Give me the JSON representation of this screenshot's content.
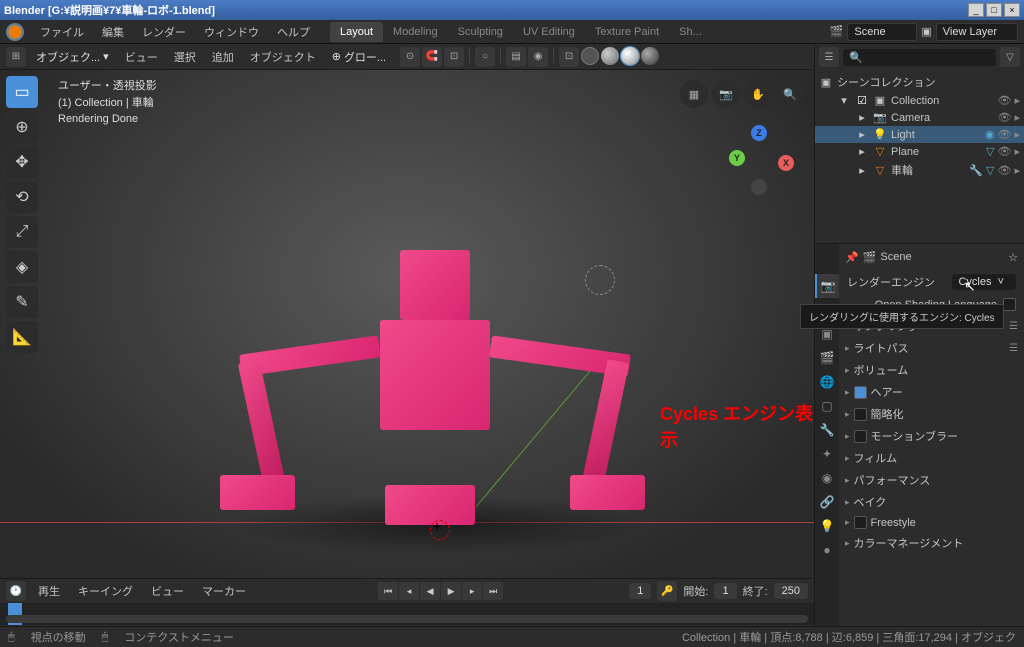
{
  "titlebar": {
    "text": "Blender [G:¥説明画¥7¥車輪-ロボ-1.blend]",
    "min": "_",
    "max": "□",
    "close": "×"
  },
  "menubar": {
    "items": [
      "ファイル",
      "編集",
      "レンダー",
      "ウィンドウ",
      "ヘルプ"
    ],
    "workspaces": [
      "Layout",
      "Modeling",
      "Sculpting",
      "UV Editing",
      "Texture Paint",
      "Sh..."
    ],
    "scene_label": "Scene",
    "viewlayer_label": "View Layer"
  },
  "vp_header": {
    "mode": "オブジェク...",
    "menus": [
      "ビュー",
      "選択",
      "追加",
      "オブジェクト"
    ],
    "global": "グロー..."
  },
  "vp_overlay": {
    "line1": "ユーザー・透視投影",
    "line2": "(1) Collection | 車輪",
    "line3": "Rendering Done"
  },
  "axis": {
    "x": "X",
    "y": "Y",
    "z": "Z"
  },
  "annotation": "Cycles エンジン表示",
  "timeline": {
    "menus": [
      "再生",
      "キーイング",
      "ビュー",
      "マーカー"
    ],
    "frame": "1",
    "start_label": "開始:",
    "start": "1",
    "end_label": "終了:",
    "end": "250"
  },
  "outliner": {
    "root": "シーンコレクション",
    "collection": "Collection",
    "items": [
      "Camera",
      "Light",
      "Plane",
      "車輪"
    ]
  },
  "properties": {
    "header": "Scene",
    "engine_label": "レンダーエンジン",
    "engine_value": "Cycles",
    "tooltip": "レンダリングに使用するエンジン: Cycles",
    "osl": "Open Shading Language",
    "panels": [
      "サンプリング",
      "ライトパス",
      "ボリューム",
      "ヘアー",
      "簡略化",
      "モーションブラー",
      "フィルム",
      "パフォーマンス",
      "ベイク",
      "Freestyle",
      "カラーマネージメント"
    ]
  },
  "statusbar": {
    "item1": "視点の移動",
    "item2": "コンテクストメニュー",
    "right": "Collection | 車輪 | 頂点:8,788 | 辺:6,859 | 三角面:17,294 | オブジェク"
  }
}
